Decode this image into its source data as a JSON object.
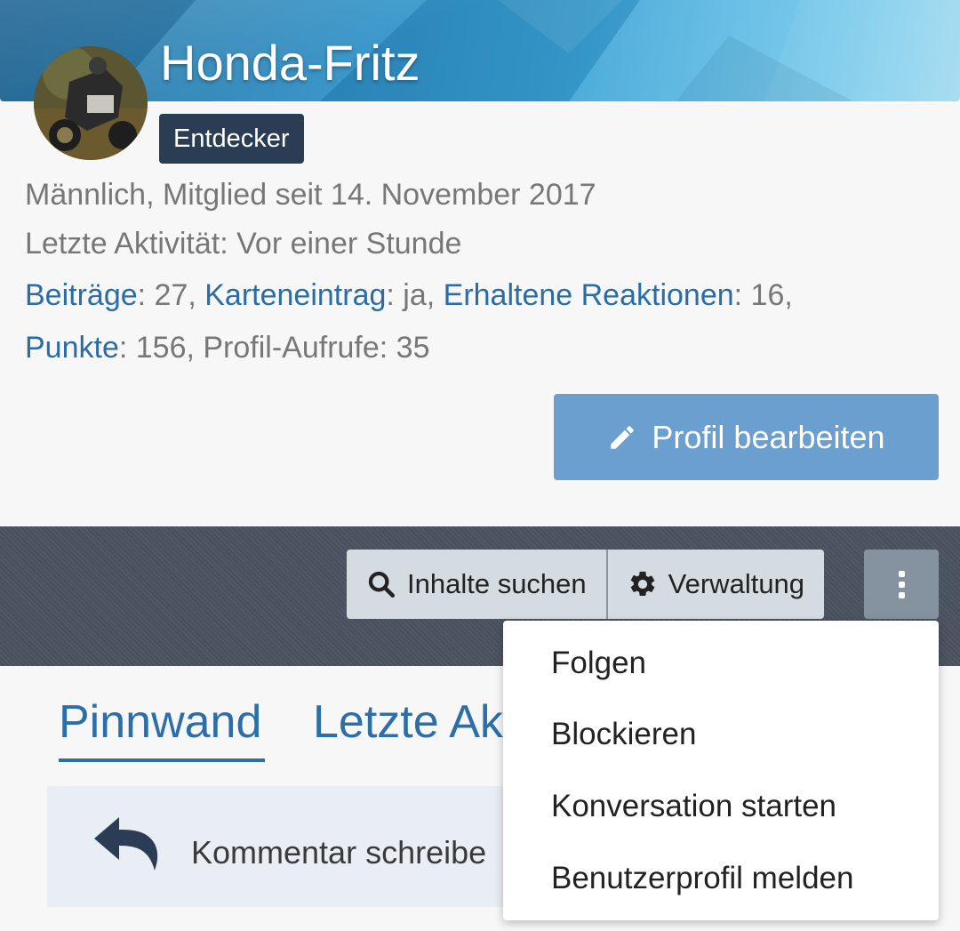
{
  "profile": {
    "username": "Honda-Fritz",
    "badge": "Entdecker",
    "line1": "Männlich, Mitglied seit 14. November 2017",
    "line2": "Letzte Aktivität: Vor einer Stunde",
    "stats": {
      "beitraege_label": "Beiträge",
      "beitraege_value": ": 27, ",
      "karteneintrag_label": "Karteneintrag",
      "karteneintrag_value": ": ja, ",
      "reaktionen_label": "Erhaltene Reaktionen",
      "reaktionen_value": ": 16,",
      "punkte_label": "Punkte",
      "punkte_value": ": 156, Profil-Aufrufe: 35"
    },
    "edit_button": "Profil bearbeiten"
  },
  "toolbar": {
    "search_label": "Inhalte suchen",
    "admin_label": "Verwaltung"
  },
  "tabs": [
    {
      "label": "Pinnwand"
    },
    {
      "label": "Letzte Ak"
    }
  ],
  "comment": {
    "placeholder": "Kommentar schreibe"
  },
  "menu": {
    "items": [
      "Folgen",
      "Blockieren",
      "Konversation starten",
      "Benutzerprofil melden"
    ]
  },
  "colors": {
    "link": "#2a6da5",
    "edit_button": "#6b9fcf",
    "badge": "#2a3d55",
    "toolbar_band": "#4a5260"
  },
  "icons": [
    "pencil-icon",
    "search-icon",
    "gear-icon",
    "more-vertical-icon",
    "reply-icon"
  ]
}
